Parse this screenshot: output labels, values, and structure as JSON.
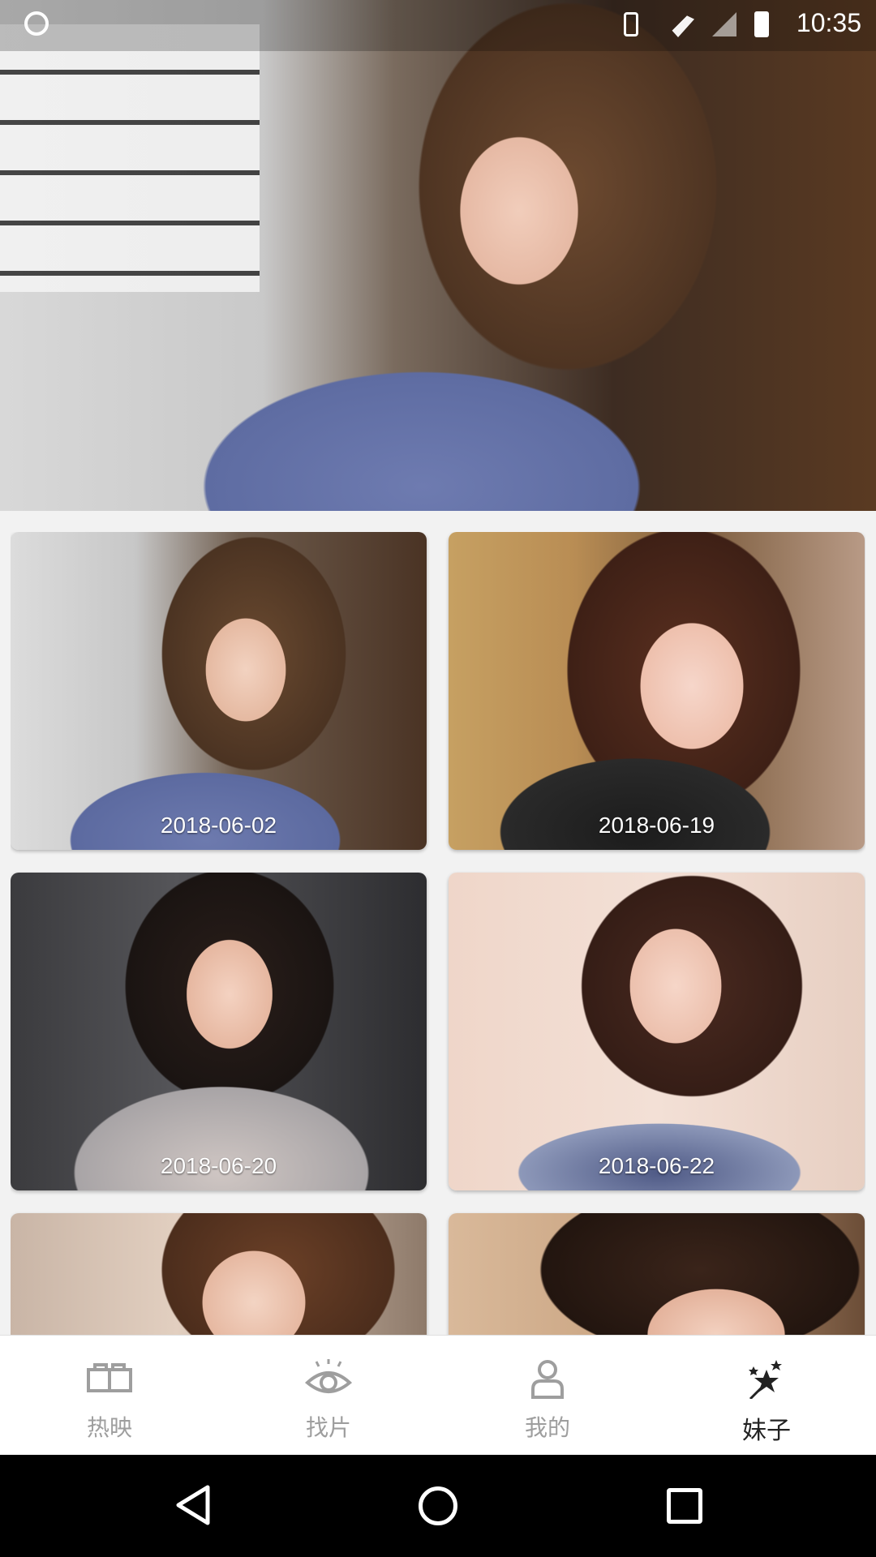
{
  "status_bar": {
    "time": "10:35",
    "icons": [
      "notification-circle-icon",
      "vibrate-icon",
      "wifi-off-icon",
      "no-signal-icon",
      "battery-charging-icon"
    ]
  },
  "cards": [
    {
      "date": "2018-06-02"
    },
    {
      "date": "2018-06-19"
    },
    {
      "date": "2018-06-20"
    },
    {
      "date": "2018-06-22"
    },
    {
      "date": ""
    },
    {
      "date": ""
    }
  ],
  "bottom_nav": {
    "items": [
      {
        "label": "热映",
        "icon": "ticket-icon"
      },
      {
        "label": "找片",
        "icon": "eye-icon"
      },
      {
        "label": "我的",
        "icon": "person-icon"
      },
      {
        "label": "妹子",
        "icon": "stars-wand-icon"
      }
    ],
    "active_index": 3
  },
  "colors": {
    "active": "#222222",
    "inactive": "#9e9e9e",
    "background": "#f2f2f2"
  }
}
